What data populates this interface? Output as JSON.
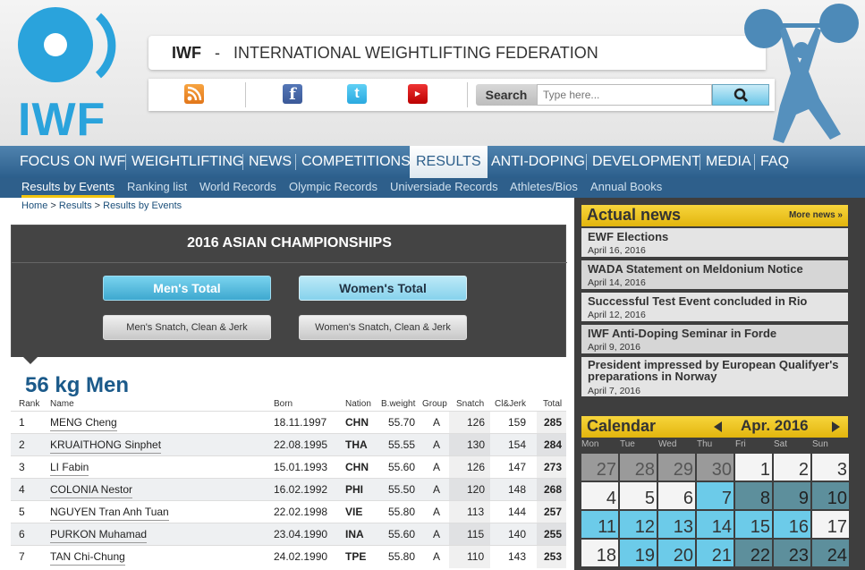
{
  "header": {
    "logo_text": "IWF",
    "org_abbr": "IWF",
    "org_separator": "-",
    "org_name": "INTERNATIONAL WEIGHTLIFTING FEDERATION",
    "search_label": "Search",
    "search_placeholder": "Type here...",
    "brand_color": "#2aa3dc"
  },
  "nav": {
    "items": [
      "FOCUS ON IWF",
      "WEIGHTLIFTING",
      "NEWS",
      "COMPETITIONS",
      "RESULTS",
      "ANTI-DOPING",
      "DEVELOPMENT",
      "MEDIA",
      "FAQ"
    ],
    "active": "RESULTS"
  },
  "subnav": {
    "items": [
      "Results by Events",
      "Ranking list",
      "World Records",
      "Olympic Records",
      "Universiade Records",
      "Athletes/Bios",
      "Annual Books"
    ],
    "active": "Results by Events"
  },
  "breadcrumb": [
    "Home",
    "Results",
    "Results by Events"
  ],
  "event": {
    "title": "2016 ASIAN CHAMPIONSHIPS",
    "btn_mens_total": "Men's Total",
    "btn_womens_total": "Women's Total",
    "btn_mens_snatch": "Men's Snatch, Clean & Jerk",
    "btn_womens_snatch": "Women's Snatch, Clean & Jerk"
  },
  "results": {
    "category": "56 kg Men",
    "headers": [
      "Rank",
      "Name",
      "Born",
      "Nation",
      "B.weight",
      "Group",
      "Snatch",
      "Cl&Jerk",
      "Total"
    ],
    "rows": [
      [
        "1",
        "MENG Cheng",
        "18.11.1997",
        "CHN",
        "55.70",
        "A",
        "126",
        "159",
        "285"
      ],
      [
        "2",
        "KRUAITHONG Sinphet",
        "22.08.1995",
        "THA",
        "55.55",
        "A",
        "130",
        "154",
        "284"
      ],
      [
        "3",
        "LI Fabin",
        "15.01.1993",
        "CHN",
        "55.60",
        "A",
        "126",
        "147",
        "273"
      ],
      [
        "4",
        "COLONIA Nestor",
        "16.02.1992",
        "PHI",
        "55.50",
        "A",
        "120",
        "148",
        "268"
      ],
      [
        "5",
        "NGUYEN Tran Anh Tuan",
        "22.02.1998",
        "VIE",
        "55.80",
        "A",
        "113",
        "144",
        "257"
      ],
      [
        "6",
        "PURKON Muhamad",
        "23.04.1990",
        "INA",
        "55.60",
        "A",
        "115",
        "140",
        "255"
      ],
      [
        "7",
        "TAN Chi-Chung",
        "24.02.1990",
        "TPE",
        "55.80",
        "A",
        "110",
        "143",
        "253"
      ]
    ]
  },
  "news": {
    "heading": "Actual news",
    "more": "More news »",
    "items": [
      {
        "title": "EWF Elections",
        "date": "April 16, 2016"
      },
      {
        "title": "WADA Statement on Meldonium Notice",
        "date": "April 14, 2016"
      },
      {
        "title": "Successful Test Event concluded in Rio",
        "date": "April 12, 2016"
      },
      {
        "title": "IWF Anti-Doping Seminar in Forde",
        "date": "April 9, 2016"
      },
      {
        "title": "President impressed by European Qualifyer's preparations in Norway",
        "date": "April 7, 2016"
      }
    ]
  },
  "calendar": {
    "heading": "Calendar",
    "month": "Apr. 2016",
    "weekdays": [
      "Mon",
      "Tue",
      "Wed",
      "Thu",
      "Fri",
      "Sat",
      "Sun"
    ],
    "weeks": [
      [
        "27",
        "28",
        "29",
        "30",
        "1",
        "2",
        "3"
      ],
      [
        "4",
        "5",
        "6",
        "7",
        "8",
        "9",
        "10"
      ],
      [
        "11",
        "12",
        "13",
        "14",
        "15",
        "16",
        "17"
      ],
      [
        "18",
        "19",
        "20",
        "21",
        "22",
        "23",
        "24"
      ]
    ]
  }
}
